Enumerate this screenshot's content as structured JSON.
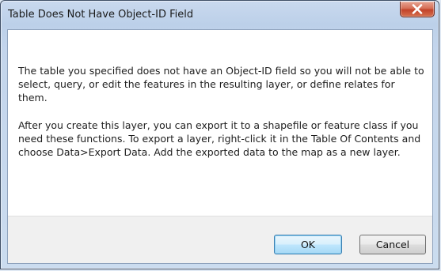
{
  "dialog": {
    "title": "Table Does Not Have Object-ID Field",
    "close_icon": "close-x-icon",
    "colors": {
      "close_button": "#c9472e",
      "frame": "#c3d5ec",
      "default_button_border": "#3c7fb1"
    }
  },
  "message": {
    "paragraph1": "The table you specified does not have an Object-ID field so you will not be able to select, query, or edit the features in the resulting layer, or define relates for them.",
    "paragraph2": "After you create this layer, you can export it to a shapefile or feature class if you need these functions. To export a layer, right-click it in the Table Of Contents and choose Data>Export Data. Add the exported data to the map as a new layer."
  },
  "buttons": {
    "ok": "OK",
    "cancel": "Cancel"
  }
}
